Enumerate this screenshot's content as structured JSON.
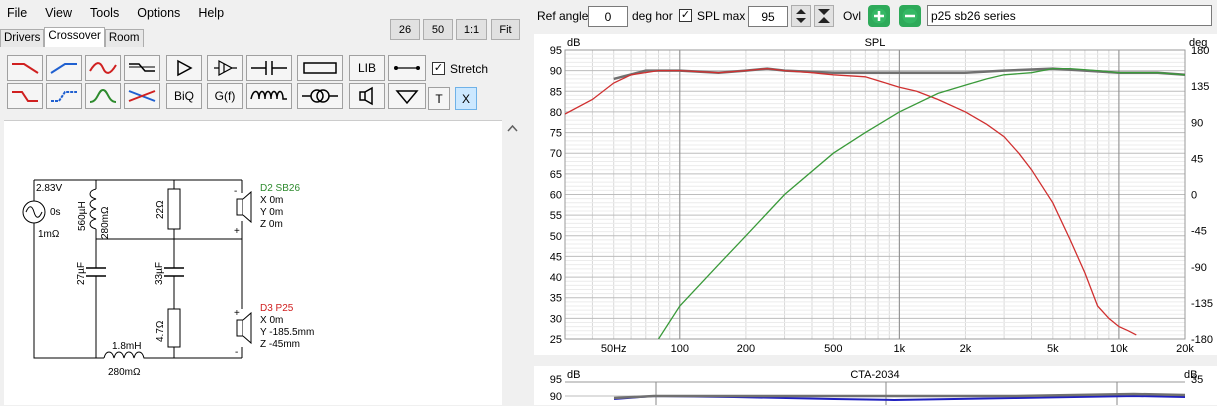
{
  "menu": [
    "File",
    "View",
    "Tools",
    "Options",
    "Help"
  ],
  "zoom_buttons": [
    "26",
    "50",
    "1:1",
    "Fit"
  ],
  "tabs": [
    "Drivers",
    "Crossover",
    "Room"
  ],
  "toolbar": {
    "lib_label": "LIB",
    "biq_label": "BiQ",
    "gf_label": "G(f)",
    "t_label": "T",
    "x_label": "X",
    "stretch_label": "Stretch",
    "stretch_checked": true
  },
  "schematic": {
    "source_voltage": "2.83V",
    "source_delay": "0s",
    "source_resistance": "1mΩ",
    "l1_value": "560µH",
    "l1_resistance": "280mΩ",
    "r1_value": "22Ω",
    "c1_value": "27µF",
    "c2_value": "33µF",
    "r2_value": "4.7Ω",
    "l2_value": "1.8mH",
    "l2_resistance": "280mΩ",
    "d2": {
      "name": "D2 SB26",
      "x": "X 0m",
      "y": "Y 0m",
      "z": "Z 0m",
      "color": "#2e8b2e"
    },
    "d3": {
      "name": "D3 P25",
      "x": "X 0m",
      "y": "Y -185.5mm",
      "z": "Z -45mm",
      "color": "#d02020"
    }
  },
  "controls": {
    "ref_angle_label": "Ref angle",
    "ref_angle_value": "0",
    "ref_angle_unit": "deg hor",
    "spl_max_label": "SPL max",
    "spl_max_checked": true,
    "spl_max_value": "95",
    "ovl_label": "Ovl",
    "series_name": "p25 sb26 series"
  },
  "chart_data": [
    {
      "type": "line",
      "title": "SPL",
      "ylabel_left": "dB",
      "ylabel_right": "deg",
      "xscale": "log",
      "xlim": [
        30,
        20000
      ],
      "ylim": [
        25,
        95
      ],
      "ylim_right": [
        -180,
        180
      ],
      "yticks": [
        "95",
        "90",
        "85",
        "80",
        "75",
        "70",
        "65",
        "60",
        "55",
        "50",
        "45",
        "40",
        "35",
        "30",
        "25"
      ],
      "yticks_right": [
        "180",
        "135",
        "90",
        "45",
        "0",
        "-45",
        "-90",
        "-135",
        "-180"
      ],
      "xticks": [
        "50Hz",
        "100",
        "200",
        "500",
        "1k",
        "2k",
        "5k",
        "10k",
        "20k"
      ],
      "grid": true,
      "series": [
        {
          "color": "#d03030",
          "x": [
            30,
            40,
            50,
            60,
            80,
            100,
            150,
            200,
            250,
            300,
            400,
            500,
            700,
            1000,
            1200,
            1500,
            2000,
            2500,
            3000,
            3500,
            4000,
            5000,
            6000,
            7000,
            8000,
            9000,
            10000,
            11000,
            12000
          ],
          "y": [
            79.5,
            83,
            87,
            89,
            90,
            90,
            89.5,
            90,
            90.5,
            90,
            89.5,
            89,
            88.5,
            86,
            85,
            83,
            80,
            77,
            74,
            70,
            66,
            58,
            49,
            41,
            33,
            30,
            28,
            27,
            26
          ]
        },
        {
          "color": "#3a9a3a",
          "x": [
            80,
            100,
            150,
            200,
            300,
            500,
            700,
            1000,
            1500,
            2000,
            2500,
            3000,
            4000,
            5000,
            6000,
            8000,
            10000,
            15000,
            20000
          ],
          "y": [
            25,
            33,
            43,
            50,
            60,
            70,
            75,
            80,
            84.5,
            86.5,
            88,
            89,
            89.5,
            90.5,
            90.5,
            90,
            89.5,
            89.5,
            89
          ]
        },
        {
          "color": "#707070",
          "x": [
            50,
            70,
            100,
            150,
            200,
            250,
            300,
            500,
            700,
            1000,
            2000,
            3000,
            5000,
            7000,
            10000,
            15000,
            20000
          ],
          "y": [
            88,
            90,
            90,
            89.5,
            90,
            90.5,
            90,
            89.5,
            89.5,
            89.5,
            89.5,
            90,
            90.5,
            90,
            89.5,
            89.5,
            89
          ]
        }
      ]
    },
    {
      "type": "line",
      "title": "CTA-2034",
      "ylabel_left": "dB",
      "ylabel_right": "dB",
      "yticks": [
        "95",
        "90"
      ],
      "yticks_right": [
        "35"
      ],
      "series": [
        {
          "color": "#707070"
        },
        {
          "color": "#2020c0"
        }
      ]
    }
  ]
}
